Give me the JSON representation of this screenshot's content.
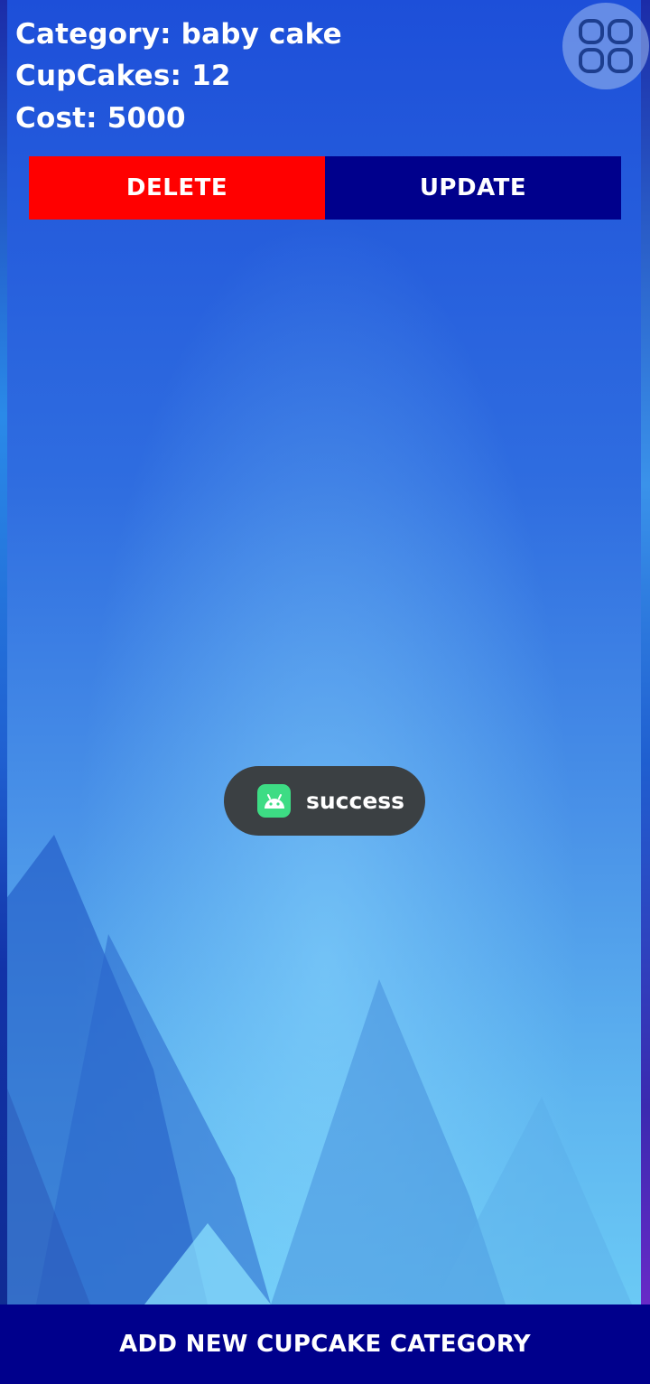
{
  "details": {
    "category_line": "Category: baby cake",
    "cupcakes_line": "CupCakes: 12",
    "cost_line": "Cost: 5000"
  },
  "actions": {
    "delete_label": "DELETE",
    "update_label": "UPDATE"
  },
  "toast": {
    "message": "success",
    "icon": "android-icon"
  },
  "footer": {
    "add_label": "ADD NEW CUPCAKE CATEGORY"
  },
  "floating_button": {
    "icon": "grid-icon"
  },
  "colors": {
    "delete": "#ff0000",
    "update": "#00008c",
    "footer": "#00008c",
    "toast_bg": "#3b4043",
    "android_green": "#3ddc84"
  }
}
